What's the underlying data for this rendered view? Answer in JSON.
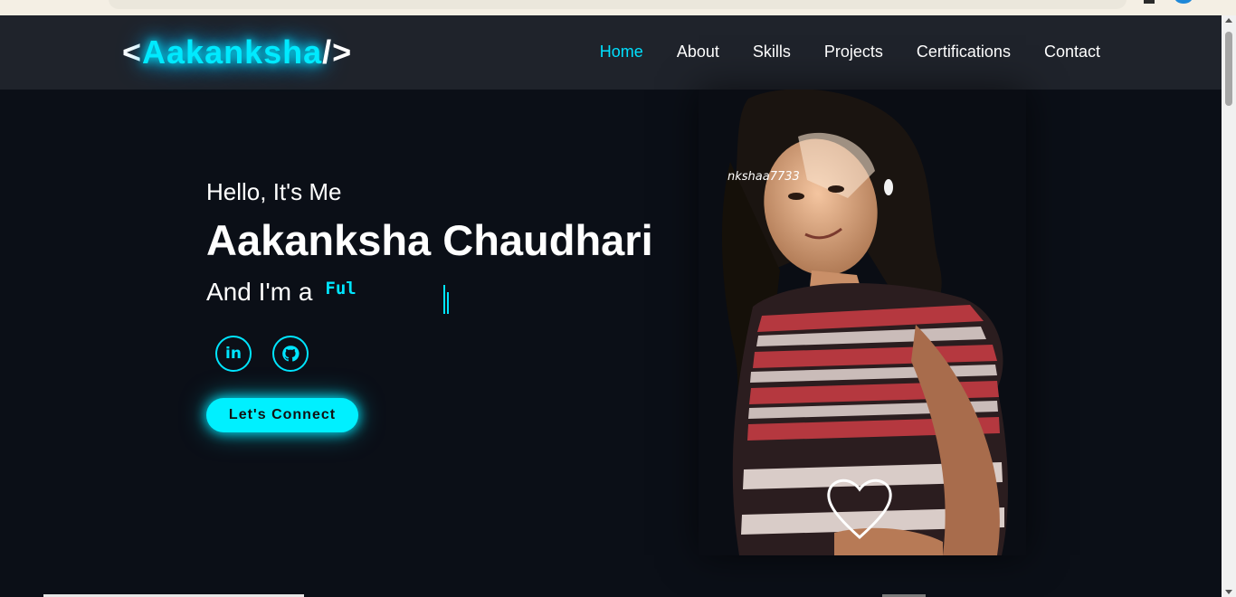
{
  "brand": {
    "open": "<",
    "name": "Aakanksha",
    "close": "/>"
  },
  "nav": {
    "items": [
      {
        "label": "Home",
        "active": true
      },
      {
        "label": "About",
        "active": false
      },
      {
        "label": "Skills",
        "active": false
      },
      {
        "label": "Projects",
        "active": false
      },
      {
        "label": "Certifications",
        "active": false
      },
      {
        "label": "Contact",
        "active": false
      }
    ]
  },
  "hero": {
    "greeting": "Hello, It's Me",
    "name": "Aakanksha Chaudhari",
    "role_prefix": "And I'm a",
    "role_typed": "Ful",
    "cta_label": "Let's Connect"
  },
  "socials": [
    {
      "icon": "linkedin-icon",
      "glyph": "in"
    },
    {
      "icon": "github-icon"
    }
  ],
  "photo": {
    "overlay_text": "nkshaa7733"
  },
  "colors": {
    "accent": "#00e5ff",
    "background": "#0b0f17",
    "navbar": "#1f232b"
  }
}
